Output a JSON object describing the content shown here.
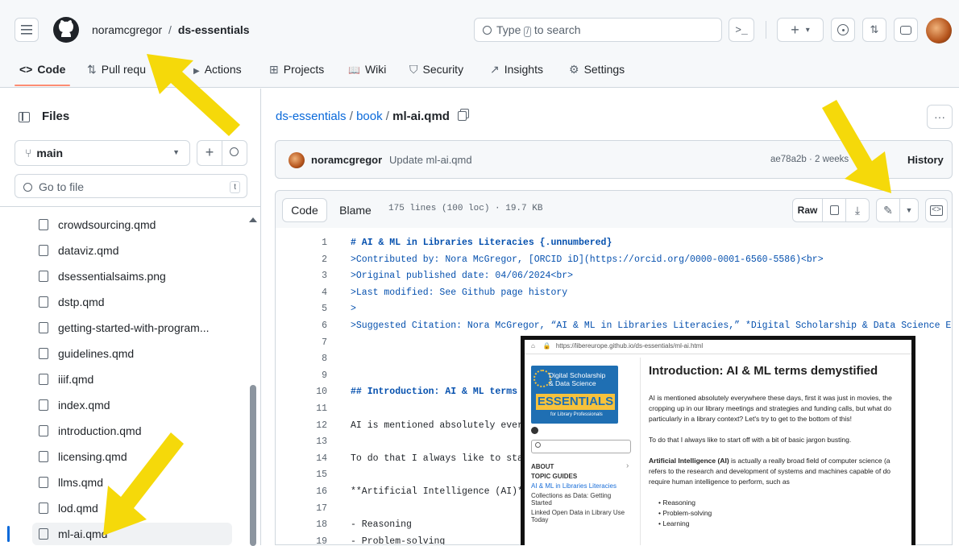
{
  "header": {
    "owner": "noramcgregor",
    "sep": "/",
    "repo": "ds-essentials",
    "search_pre": "Type",
    "search_key": "/",
    "search_post": "to search",
    "plus": "+",
    "caret": "▾"
  },
  "tabs": [
    {
      "icon": "<>",
      "label": "Code"
    },
    {
      "icon": "⇅",
      "label": "Pull requ"
    },
    {
      "icon": "▶",
      "label": "Actions"
    },
    {
      "icon": "⊞",
      "label": "Projects"
    },
    {
      "icon": "📖",
      "label": "Wiki"
    },
    {
      "icon": "⛉",
      "label": "Security"
    },
    {
      "icon": "↗",
      "label": "Insights"
    },
    {
      "icon": "⚙",
      "label": "Settings"
    }
  ],
  "sidebar": {
    "title": "Files",
    "branch": "main",
    "goto": "Go to file",
    "goto_key": "t",
    "files": [
      "crowdsourcing.qmd",
      "dataviz.qmd",
      "dsessentialsaims.png",
      "dstp.qmd",
      "getting-started-with-program...",
      "guidelines.qmd",
      "iiif.qmd",
      "index.qmd",
      "introduction.qmd",
      "licensing.qmd",
      "llms.qmd",
      "lod.qmd",
      "ml-ai.qmd"
    ]
  },
  "breadcrumb": {
    "repo": "ds-essentials",
    "sep1": "/",
    "folder": "book",
    "sep2": "/",
    "file": "ml-ai.qmd",
    "more": "···"
  },
  "commit": {
    "author": "noramcgregor",
    "message": "Update ml-ai.qmd",
    "meta": "ae78a2b · 2 weeks",
    "history": "History"
  },
  "codeheader": {
    "code": "Code",
    "blame": "Blame",
    "stats": "175 lines (100 loc) · 19.7 KB",
    "raw": "Raw"
  },
  "code_lines": [
    {
      "n": "1",
      "t": "# AI & ML in Libraries Literacies {.unnumbered}",
      "c": "h"
    },
    {
      "n": "2",
      "t": ">Contributed by: Nora McGregor, [ORCID iD](https://orcid.org/0000-0001-6560-5586)<br>",
      "c": "q"
    },
    {
      "n": "3",
      "t": ">Original published date: 04/06/2024<br>",
      "c": "q"
    },
    {
      "n": "4",
      "t": ">Last modified: See Github page history",
      "c": "q"
    },
    {
      "n": "5",
      "t": ">",
      "c": "q"
    },
    {
      "n": "6",
      "t": ">Suggested Citation: Nora McGregor, “AI & ML in Libraries Literacies,” *Digital Scholarship & Data Science Essent",
      "c": "q"
    },
    {
      "n": "7",
      "t": "",
      "c": ""
    },
    {
      "n": "8",
      "t": "",
      "c": ""
    },
    {
      "n": "9",
      "t": "",
      "c": ""
    },
    {
      "n": "10",
      "t": "## Introduction: AI & ML terms d",
      "c": "h"
    },
    {
      "n": "11",
      "t": "",
      "c": ""
    },
    {
      "n": "12",
      "t": "AI is mentioned absolutely every                                                              ing up",
      "c": ""
    },
    {
      "n": "13",
      "t": "",
      "c": ""
    },
    {
      "n": "14",
      "t": "To do that I always like to star",
      "c": ""
    },
    {
      "n": "15",
      "t": "",
      "c": ""
    },
    {
      "n": "16",
      "t": "**Artificial Intelligence (AI)**                                                              ) that",
      "c": ""
    },
    {
      "n": "17",
      "t": "",
      "c": ""
    },
    {
      "n": "18",
      "t": "- Reasoning",
      "c": ""
    },
    {
      "n": "19",
      "t": "- Problem-solving",
      "c": ""
    }
  ],
  "overlay": {
    "url": "https://libereurope.github.io/ds-essentials/ml-ai.html",
    "logo_line1": "Digital Scholarship",
    "logo_line2": "& Data Science",
    "logo_big": "ESSENTIALS",
    "logo_small": "for Library Professionals",
    "nav_about": "ABOUT",
    "nav_topic": "TOPIC GUIDES",
    "nav_active": "AI & ML in Libraries Literacies",
    "nav_item2": "Collections as Data: Getting Started",
    "nav_item3": "Linked Open Data in Library Use Today",
    "heading": "Introduction: AI & ML terms demystified",
    "p1": "AI is mentioned absolutely everywhere these days, first it was just in movies, the",
    "p1b": "cropping up in our library meetings and strategies and funding calls, but what do",
    "p1c": "particularly in a library context? Let's try to get to the bottom of this!",
    "p2": "To do that I always like to start off with a bit of basic jargon busting.",
    "p3a": "Artificial Intelligence (AI)",
    "p3b": " is actually a really broad field of computer science (a",
    "p3c": "refers to the research and development of systems and machines capable of do",
    "p3d": "require human intelligence to perform, such as",
    "bullets": [
      "Reasoning",
      "Problem-solving",
      "Learning"
    ]
  },
  "colors": {
    "accent": "#0969da",
    "arrow": "#f5d90a",
    "tab_underline": "#fd8c73"
  }
}
